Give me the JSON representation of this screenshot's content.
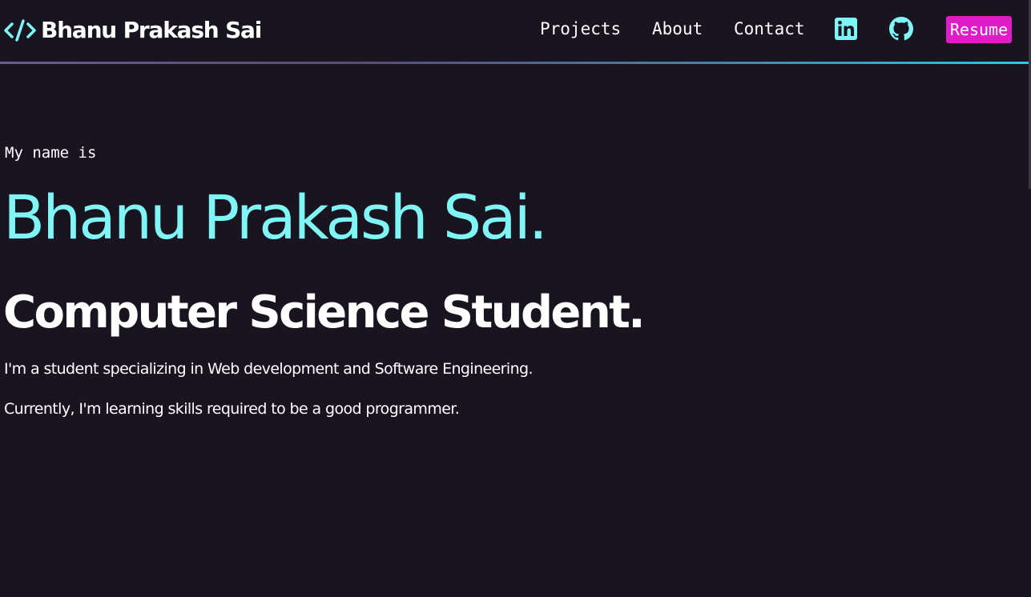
{
  "nav": {
    "brand_name": "Bhanu Prakash Sai",
    "links": [
      "Projects",
      "About",
      "Contact"
    ],
    "resume_label": "Resume"
  },
  "hero": {
    "intro": "My name is",
    "name": "Bhanu Prakash Sai.",
    "role": "Computer Science Student.",
    "description_1": "I'm a student specializing in Web development and Software Engineering.",
    "description_2": "Currently, I'm learning skills required to be a good programmer."
  },
  "colors": {
    "background": "#181420",
    "accent_cyan": "#7ff5f5",
    "resume_button": "#e01bc8"
  },
  "icons": [
    "code-icon",
    "linkedin-icon",
    "github-icon"
  ]
}
